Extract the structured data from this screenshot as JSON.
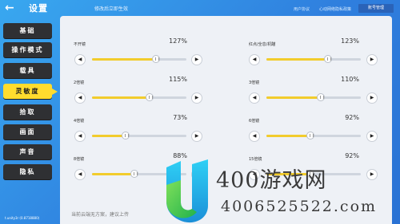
{
  "header": {
    "back_icon": "arrow-left-icon",
    "title": "设置",
    "subtitle": "修改后立即生效",
    "links": [
      "用户协议",
      "心动网络隐私政策"
    ],
    "account_button": "账号管理"
  },
  "sidebar": {
    "items": [
      {
        "label": "基础",
        "active": false
      },
      {
        "label": "操作模式",
        "active": false
      },
      {
        "label": "载具",
        "active": false
      },
      {
        "label": "灵敏度",
        "active": true
      },
      {
        "label": "拾取",
        "active": false
      },
      {
        "label": "画面",
        "active": false
      },
      {
        "label": "声音",
        "active": false
      },
      {
        "label": "隐私",
        "active": false
      }
    ]
  },
  "sensitivity": {
    "left": [
      {
        "label": "不开镜",
        "value": "127%",
        "level": 0.68
      },
      {
        "label": "2倍镜",
        "value": "115%",
        "level": 0.61
      },
      {
        "label": "4倍镜",
        "value": "73%",
        "level": 0.36
      },
      {
        "label": "8倍镜",
        "value": "88%",
        "level": 0.45
      }
    ],
    "right": [
      {
        "label": "红点/全息/机瞄",
        "value": "123%",
        "level": 0.65
      },
      {
        "label": "3倍镜",
        "value": "110%",
        "level": 0.58
      },
      {
        "label": "6倍镜",
        "value": "92%",
        "level": 0.47
      },
      {
        "label": "15倍镜",
        "value": "92%",
        "level": 0.47
      }
    ]
  },
  "cloud_tip": "当前云端无方案，建议上传",
  "uid_text": "t.unity3r (0.8718880)",
  "watermark": {
    "text": "400游戏网",
    "subtext": "4006525522.com"
  },
  "colors": {
    "accent": "#ffdc2e",
    "bg": "#2f7fde",
    "panel": "#eef1f6"
  }
}
